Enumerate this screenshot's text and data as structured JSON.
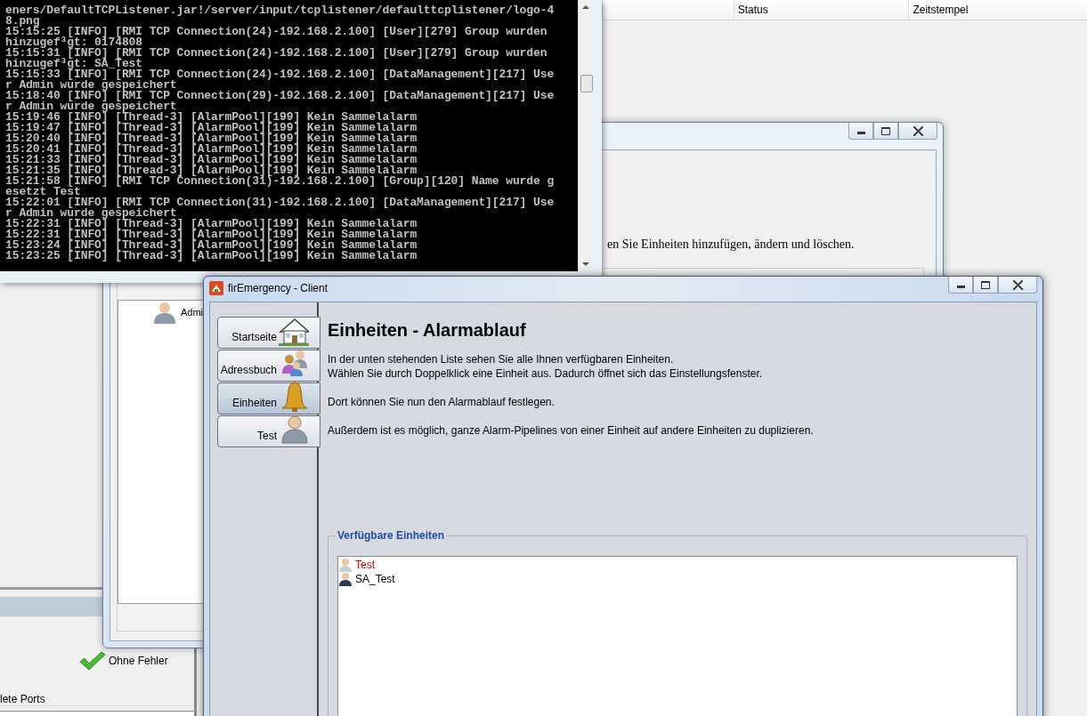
{
  "background_app": {
    "table_columns": [
      "Status",
      "Zeitstempel"
    ],
    "status_text": "Ohne Fehler",
    "section_label": "lete Ports"
  },
  "console": {
    "lines": [
      "eners/DefaultTCPListener.jar!/server/input/tcplistener/defaulttcplistener/logo-4",
      "8.png",
      "15:15:25 [INFO] [RMI TCP Connection(24)-192.168.2.100] [User][279] Group wurden",
      "hinzugef³gt: 0174808",
      "15:15:31 [INFO] [RMI TCP Connection(24)-192.168.2.100] [User][279] Group wurden",
      "hinzugef³gt: SA_Test",
      "15:15:33 [INFO] [RMI TCP Connection(24)-192.168.2.100] [DataManagement][217] Use",
      "r Admin wurde gespeichert",
      "15:18:40 [INFO] [RMI TCP Connection(29)-192.168.2.100] [DataManagement][217] Use",
      "r Admin wurde gespeichert",
      "15:19:46 [INFO] [Thread-3] [AlarmPool][199] Kein Sammelalarm",
      "15:19:47 [INFO] [Thread-3] [AlarmPool][199] Kein Sammelalarm",
      "15:20:40 [INFO] [Thread-3] [AlarmPool][199] Kein Sammelalarm",
      "15:20:41 [INFO] [Thread-3] [AlarmPool][199] Kein Sammelalarm",
      "15:21:33 [INFO] [Thread-3] [AlarmPool][199] Kein Sammelalarm",
      "15:21:35 [INFO] [Thread-3] [AlarmPool][199] Kein Sammelalarm",
      "15:21:58 [INFO] [RMI TCP Connection(31)-192.168.2.100] [Group][120] Name wurde g",
      "esetzt Test",
      "15:22:01 [INFO] [RMI TCP Connection(31)-192.168.2.100] [DataManagement][217] Use",
      "r Admin wurde gespeichert",
      "15:22:31 [INFO] [Thread-3] [AlarmPool][199] Kein Sammelalarm",
      "15:22:31 [INFO] [Thread-3] [AlarmPool][199] Kein Sammelalarm",
      "15:23:24 [INFO] [Thread-3] [AlarmPool][199] Kein Sammelalarm",
      "15:23:25 [INFO] [Thread-3] [AlarmPool][199] Kein Sammelalarm"
    ]
  },
  "units_window": {
    "description": "en Sie Einheiten hinzufügen, ändern und löschen.",
    "users": [
      {
        "label": "Admi"
      }
    ]
  },
  "client_window": {
    "title": "firEmergency - Client",
    "nav": [
      {
        "label": "Startseite",
        "kind": "house",
        "selected": false
      },
      {
        "label": "Adressbuch",
        "kind": "people",
        "selected": false
      },
      {
        "label": "Einheiten",
        "kind": "bell",
        "selected": true
      },
      {
        "label": "Test",
        "kind": "person",
        "selected": false
      }
    ],
    "heading": "Einheiten - Alarmablauf",
    "paragraphs": [
      "In der unten stehenden Liste sehen Sie alle Ihnen verfügbaren Einheiten.\nWählen Sie durch Doppelklick eine Einheit aus. Dadurch öffnet sich das Einstellungsfenster.",
      "Dort können Sie nun den Alarmablauf festlegen.",
      "Außerdem ist es möglich, ganze Alarm-Pipelines von einer Einheit auf andere Einheiten zu duplizieren."
    ],
    "group": {
      "title": "Verfügbare Einheiten",
      "items": [
        {
          "label": "Test",
          "color": "#cc0000"
        },
        {
          "label": "SA_Test",
          "color": "#000000"
        }
      ]
    }
  }
}
